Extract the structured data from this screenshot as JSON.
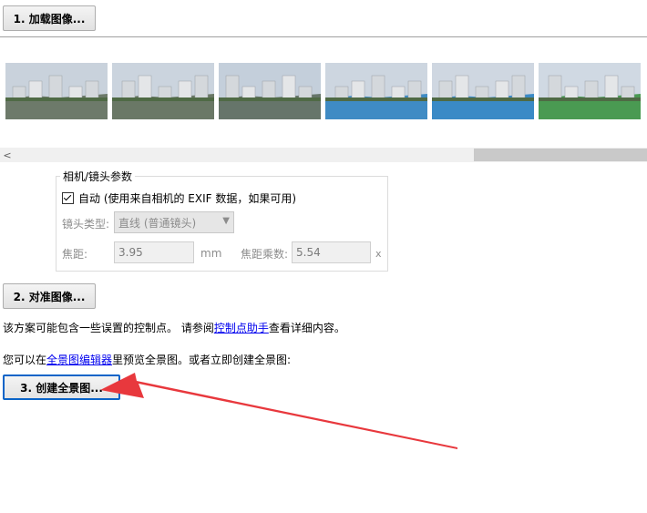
{
  "buttons": {
    "load": "1. 加载图像...",
    "align": "2. 对准图像...",
    "create": "3. 创建全景图..."
  },
  "thumbnails": [
    {
      "name": "image-1",
      "sky": "#c9d2dc",
      "ground": "#6d7a6a"
    },
    {
      "name": "image-2",
      "sky": "#cbd4de",
      "ground": "#6a7866"
    },
    {
      "name": "image-3",
      "sky": "#c4cfdb",
      "ground": "#66756a"
    },
    {
      "name": "image-4",
      "sky": "#cdd6e0",
      "ground": "#3f8bc4"
    },
    {
      "name": "image-5",
      "sky": "#cfd7e1",
      "ground": "#3a8ac6"
    },
    {
      "name": "image-6",
      "sky": "#d0d9e3",
      "ground": "#4a9a52"
    }
  ],
  "scrollbar": {
    "left_arrow": "<"
  },
  "camera": {
    "group_title": "相机/镜头参数",
    "auto_label": "自动 (使用来自相机的 EXIF 数据，如果可用)",
    "lens_type_label": "镜头类型:",
    "lens_type_value": "直线 (普通镜头)",
    "focal_length_label": "焦距:",
    "focal_length_value": "3.95",
    "focal_length_unit": "mm",
    "crop_factor_label": "焦距乘数:",
    "crop_factor_value": "5.54",
    "crop_factor_suffix": "x"
  },
  "messages": {
    "control_points_prefix": "该方案可能包含一些误置的控制点。 请参阅",
    "control_points_link": "控制点助手",
    "control_points_suffix": "查看详细内容。",
    "preview_prefix": "您可以在",
    "preview_link": "全景图编辑器",
    "preview_suffix": "里预览全景图。或者立即创建全景图:"
  },
  "colors": {
    "annotation_arrow": "#e8383d",
    "link": "#0000ee",
    "focus_border": "#0a64c8"
  }
}
